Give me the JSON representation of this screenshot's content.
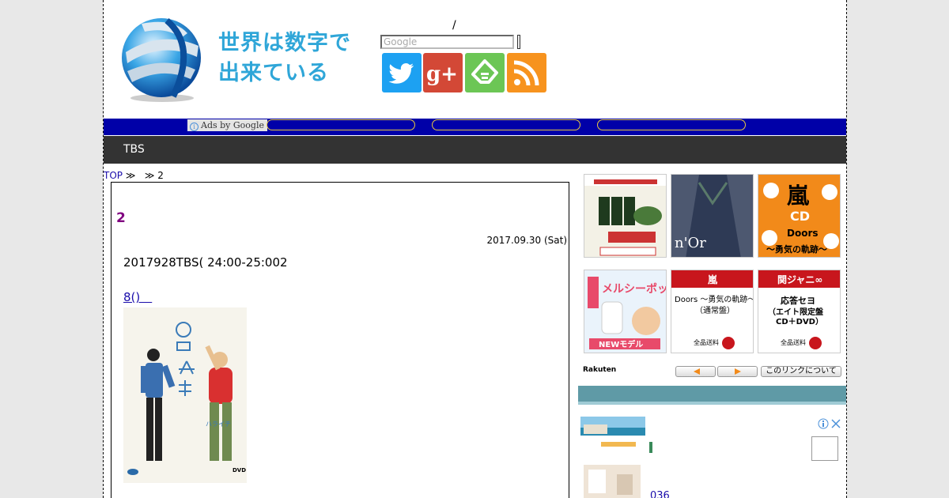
{
  "site": {
    "title_line1": "世界は数字で",
    "title_line2": "出来ている"
  },
  "header": {
    "slash": "/",
    "search_placeholder": "Google"
  },
  "adbar": {
    "label": "Ads by Google",
    "info_glyph": "i"
  },
  "nav": {
    "items": [
      "TBS"
    ]
  },
  "breadcrumb": {
    "top": "TOP",
    "sep1": " ≫  ",
    "sep2": " ≫ ",
    "current": "2"
  },
  "article": {
    "title": "2",
    "date": "2017.09.30 (Sat)",
    "body": "2017928TBS( 24:00-25:002",
    "link": "8()　"
  },
  "rakuten": {
    "brand": "Rakuten",
    "prev_icon": "arrow-left-icon",
    "next_icon": "arrow-right-icon",
    "about_label": "このリンクについて",
    "items": [
      {
        "kind": "seaweed"
      },
      {
        "kind": "fashion"
      },
      {
        "kind": "arashi-cd"
      },
      {
        "kind": "nasal-aspirator"
      },
      {
        "kind": "arashi-book"
      },
      {
        "kind": "kanjani-book"
      }
    ]
  },
  "sidebar": {
    "entry_number": "036"
  },
  "colors": {
    "adbar": "#0000a8",
    "navbar": "#333333",
    "title_purple": "#800080",
    "logo_blue": "#2fa6d8",
    "teal_bar": "#5f9aa6"
  }
}
